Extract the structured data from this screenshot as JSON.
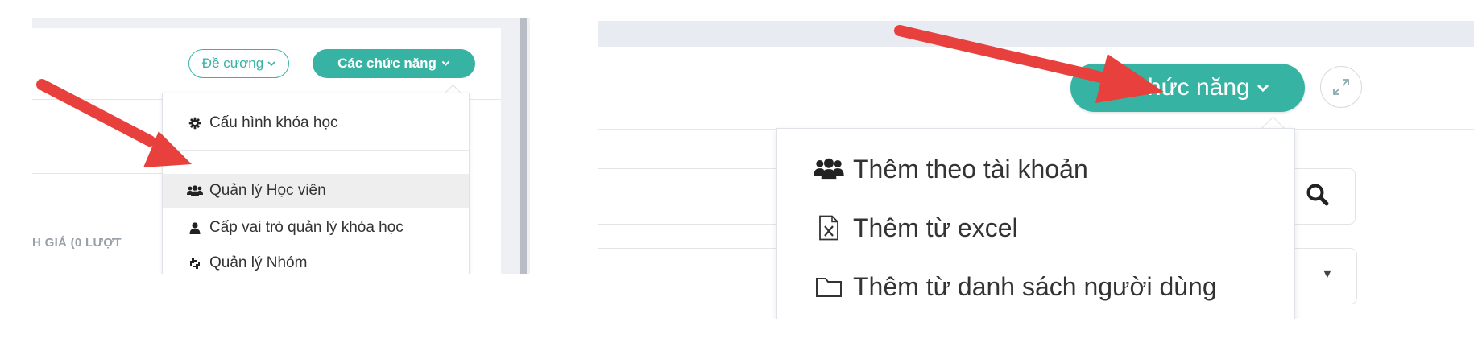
{
  "left_screenshot": {
    "outline_button": {
      "label": "Đề cương",
      "icon": "chevron-down-icon"
    },
    "functions_button": {
      "label": "Các chức năng",
      "icon": "chevron-down-icon"
    },
    "section_label": "H GIÁ (0 LƯỢT",
    "menu": {
      "items": [
        {
          "label": "Cấu hình khóa học",
          "icon": "gear-icon"
        },
        {
          "label": "Quản lý Học viên",
          "icon": "users-icon",
          "highlighted": true
        },
        {
          "label": "Cấp vai trò quản lý khóa học",
          "icon": "user-icon"
        },
        {
          "label": "Quản lý Nhóm",
          "icon": "group-exchange-icon"
        }
      ]
    }
  },
  "right_screenshot": {
    "functions_button": {
      "label": "Chức năng",
      "prefix_icon": "plus-icon",
      "suffix_icon": "chevron-down-icon"
    },
    "expand_button": {
      "icon": "expand-icon"
    },
    "search_button": {
      "icon": "search-icon"
    },
    "select_caret": "▼",
    "menu": {
      "items": [
        {
          "label": "Thêm theo tài khoản",
          "icon": "users-icon"
        },
        {
          "label": "Thêm từ excel",
          "icon": "excel-file-icon"
        },
        {
          "label": "Thêm từ danh sách người dùng",
          "icon": "folder-icon"
        }
      ]
    }
  },
  "colors": {
    "accent": "#36b3a3",
    "arrow": "#e8403c",
    "menu_highlight": "#eeeeee",
    "topbar": "#e8ebf1"
  }
}
